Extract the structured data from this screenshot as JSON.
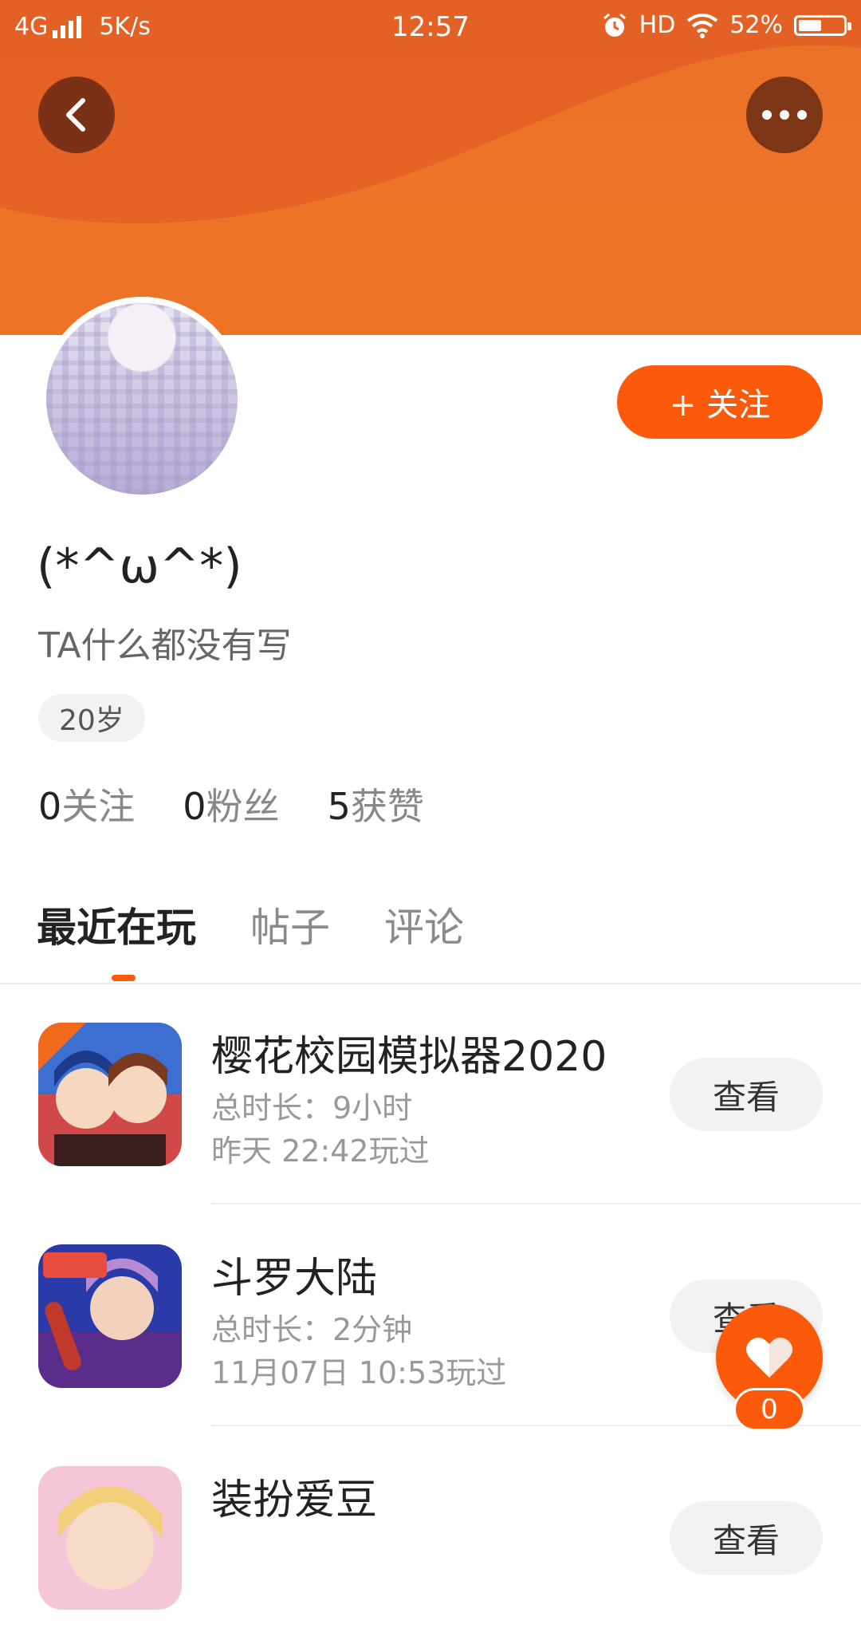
{
  "status_bar": {
    "network": "4G",
    "speed": "5K/s",
    "time": "12:57",
    "hd": "HD",
    "battery": "52%",
    "battery_level": 0.52
  },
  "header": {
    "back_icon": "chevron-left-icon",
    "more_icon": "more-dots-icon"
  },
  "profile": {
    "follow_label": "+ 关注",
    "nickname": "(*^ω^*)",
    "bio": "TA什么都没有写",
    "age": "20岁",
    "stats": [
      {
        "num": "0",
        "label": "关注"
      },
      {
        "num": "0",
        "label": "粉丝"
      },
      {
        "num": "5",
        "label": "获赞"
      }
    ]
  },
  "tabs": [
    {
      "label": "最近在玩",
      "active": true
    },
    {
      "label": "帖子",
      "active": false
    },
    {
      "label": "评论",
      "active": false
    }
  ],
  "games": [
    {
      "title": "樱花校园模拟器2020",
      "duration": "总时长：9小时",
      "last_played": "昨天 22:42玩过",
      "view_label": "查看"
    },
    {
      "title": "斗罗大陆",
      "duration": "总时长：2分钟",
      "last_played": "11月07日 10:53玩过",
      "view_label": "查看"
    },
    {
      "title": "装扮爱豆",
      "view_label": "查看"
    }
  ],
  "like": {
    "count": "0"
  },
  "colors": {
    "accent": "#fa5a0a",
    "banner": "#ea6d2a"
  }
}
